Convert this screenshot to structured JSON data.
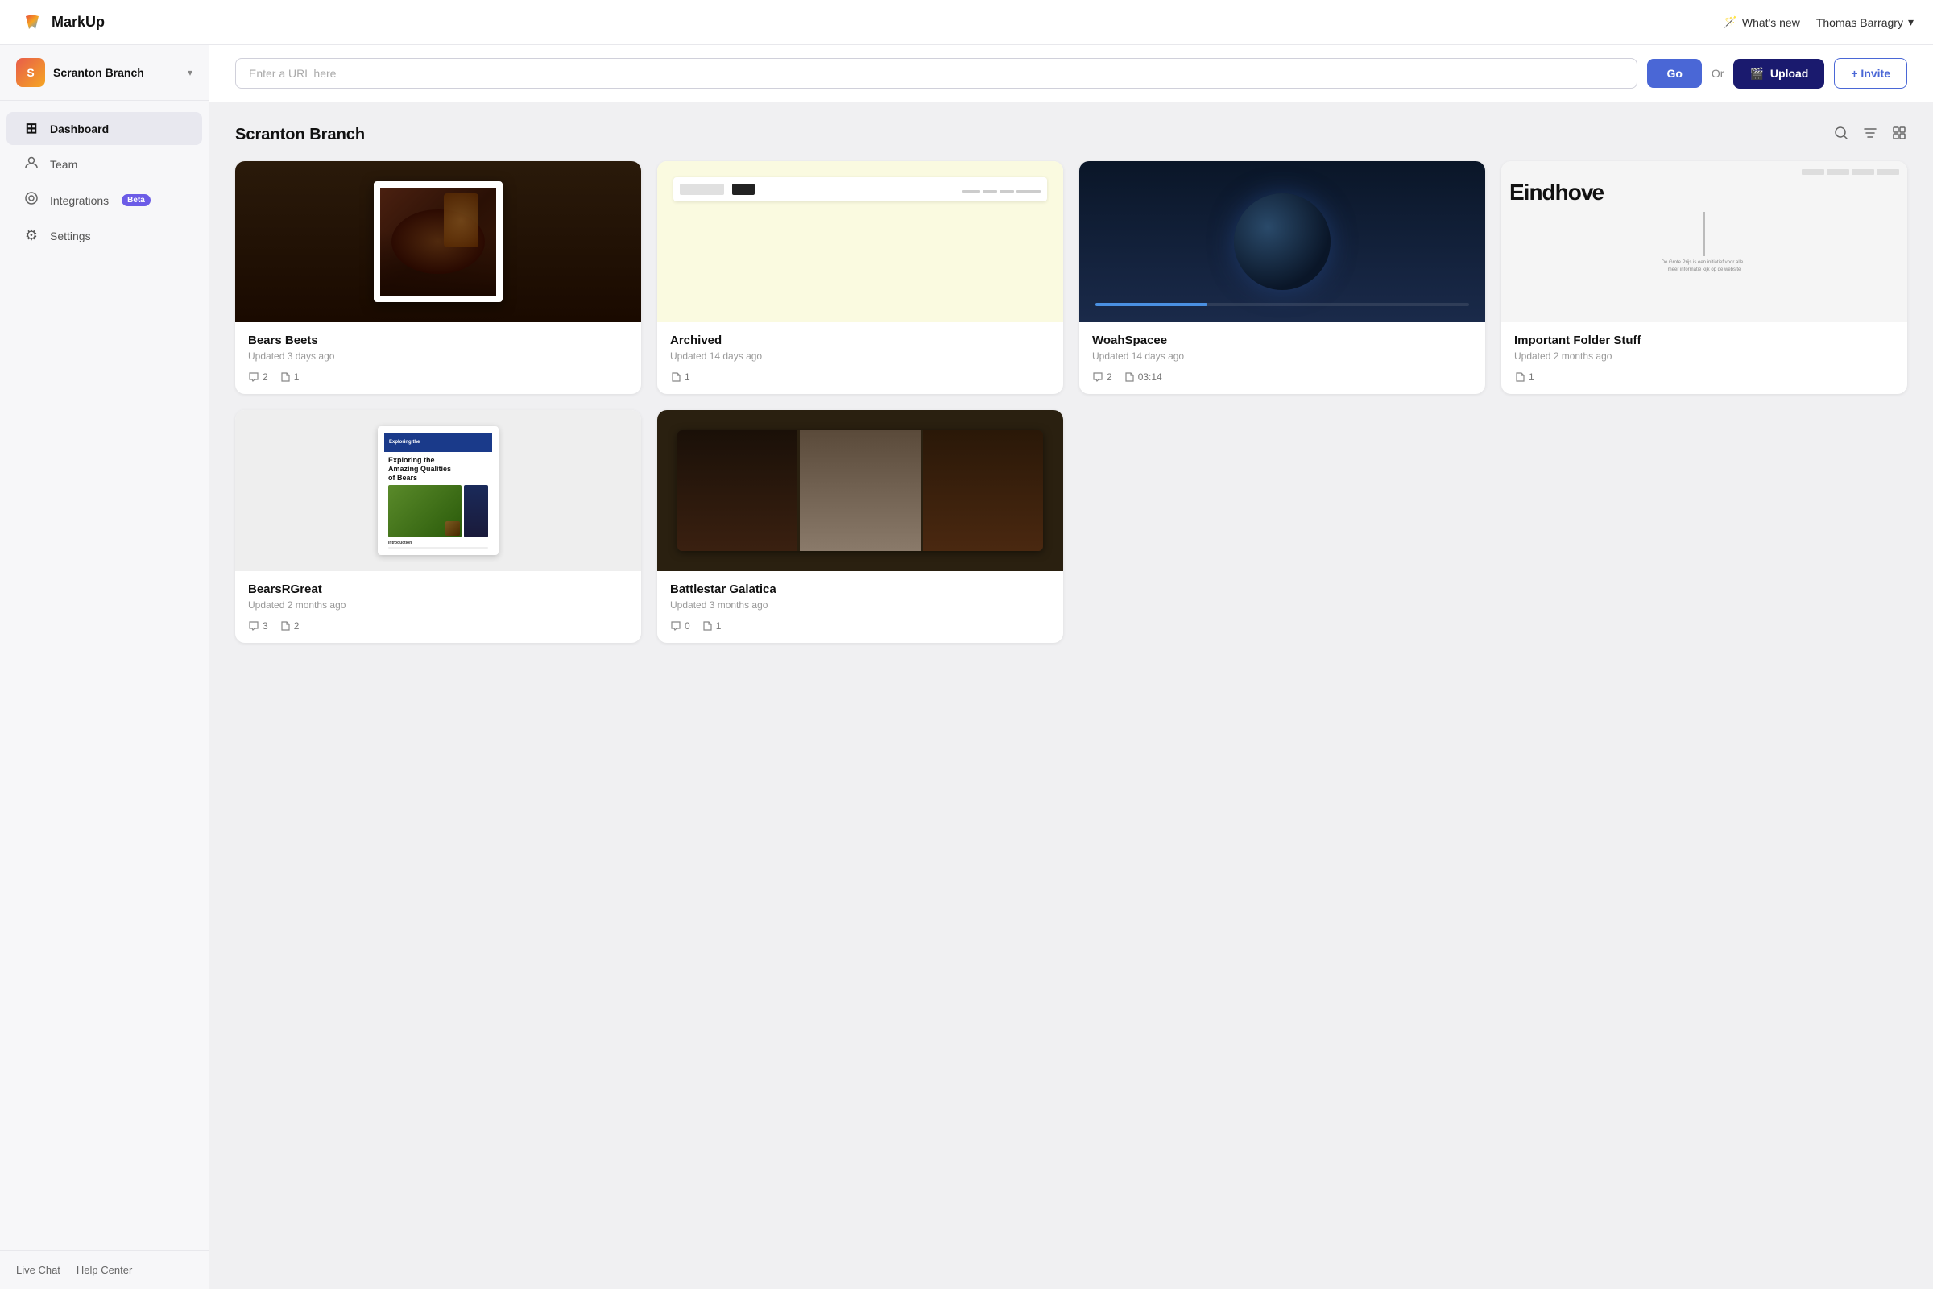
{
  "app": {
    "name": "MarkUp"
  },
  "topnav": {
    "whats_new": "What's new",
    "user_name": "Thomas Barragry",
    "chevron": "▾"
  },
  "sidebar": {
    "workspace": {
      "name": "Scranton Branch",
      "avatar_letter": "S"
    },
    "nav_items": [
      {
        "id": "dashboard",
        "label": "Dashboard",
        "icon": "⊞",
        "active": true
      },
      {
        "id": "team",
        "label": "Team",
        "icon": "○"
      },
      {
        "id": "integrations",
        "label": "Integrations",
        "icon": "◎",
        "badge": "Beta"
      },
      {
        "id": "settings",
        "label": "Settings",
        "icon": "⚙"
      }
    ],
    "bottom_links": [
      {
        "id": "live-chat",
        "label": "Live Chat"
      },
      {
        "id": "help-center",
        "label": "Help Center"
      }
    ]
  },
  "urlbar": {
    "placeholder": "Enter a URL here",
    "go_label": "Go",
    "or_label": "Or",
    "upload_label": "Upload",
    "invite_label": "+ Invite"
  },
  "dashboard": {
    "title": "Scranton Branch",
    "projects": [
      {
        "id": "bears-beets",
        "name": "Bears Beets",
        "updated": "Updated 3 days ago",
        "comments": "2",
        "files": "1",
        "thumbnail_type": "bears-beets"
      },
      {
        "id": "archived",
        "name": "Archived",
        "updated": "Updated 14 days ago",
        "comments": "",
        "files": "1",
        "thumbnail_type": "archived"
      },
      {
        "id": "woah-spacee",
        "name": "WoahSpacee",
        "updated": "Updated 14 days ago",
        "comments": "2",
        "duration": "03:14",
        "thumbnail_type": "space"
      },
      {
        "id": "important-folder-stuff",
        "name": "Important Folder Stuff",
        "updated": "Updated 2 months ago",
        "comments": "",
        "files": "1",
        "thumbnail_type": "eindh"
      },
      {
        "id": "bears-r-great",
        "name": "BearsRGreat",
        "updated": "Updated 2 months ago",
        "comments": "3",
        "files": "2",
        "thumbnail_type": "magazine"
      },
      {
        "id": "battlestar-galatica",
        "name": "Battlestar Galatica",
        "updated": "Updated 3 months ago",
        "comments": "0",
        "files": "1",
        "thumbnail_type": "battlestar"
      }
    ]
  }
}
